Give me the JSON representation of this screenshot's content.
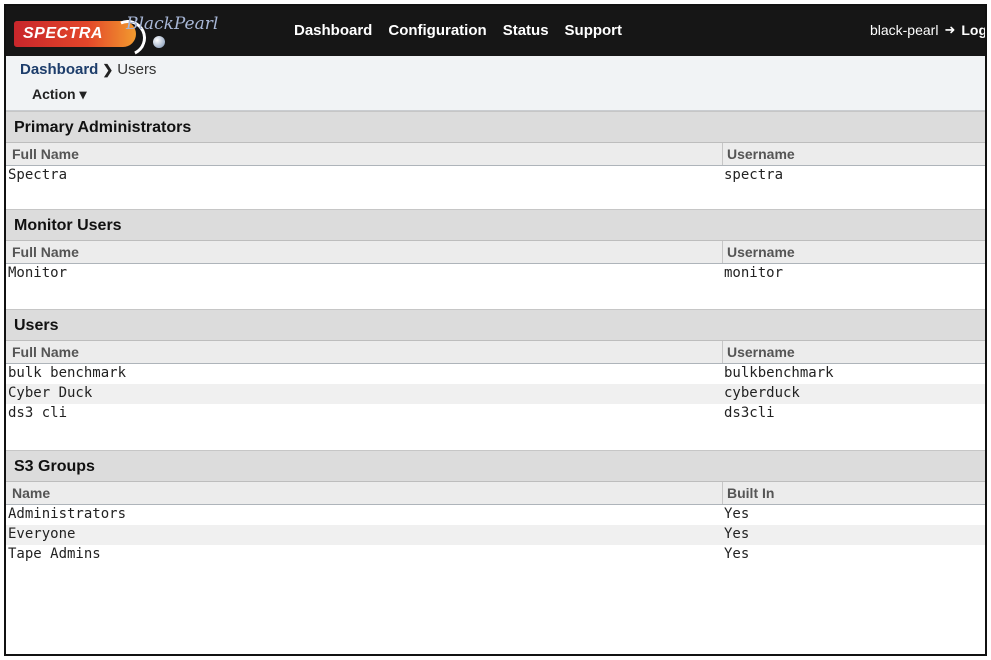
{
  "header": {
    "logo_text": "SPECTRA",
    "logo_product": "BlackPearl",
    "nav": [
      "Dashboard",
      "Configuration",
      "Status",
      "Support"
    ],
    "hostname": "black-pearl",
    "logout_label": "Log"
  },
  "breadcrumb": {
    "home": "Dashboard",
    "current": "Users"
  },
  "action_label": "Action ▾",
  "sections": [
    {
      "title": "Primary Administrators",
      "columns": [
        "Full Name",
        "Username"
      ],
      "rows": [
        [
          "Spectra",
          "spectra"
        ]
      ]
    },
    {
      "title": "Monitor Users",
      "columns": [
        "Full Name",
        "Username"
      ],
      "rows": [
        [
          "Monitor",
          "monitor"
        ]
      ]
    },
    {
      "title": "Users",
      "columns": [
        "Full Name",
        "Username"
      ],
      "rows": [
        [
          "bulk benchmark",
          "bulkbenchmark"
        ],
        [
          "Cyber Duck",
          "cyberduck"
        ],
        [
          "ds3 cli",
          "ds3cli"
        ]
      ]
    },
    {
      "title": "S3 Groups",
      "columns": [
        "Name",
        "Built In"
      ],
      "rows": [
        [
          "Administrators",
          "Yes"
        ],
        [
          "Everyone",
          "Yes"
        ],
        [
          "Tape Admins",
          "Yes"
        ]
      ]
    }
  ]
}
